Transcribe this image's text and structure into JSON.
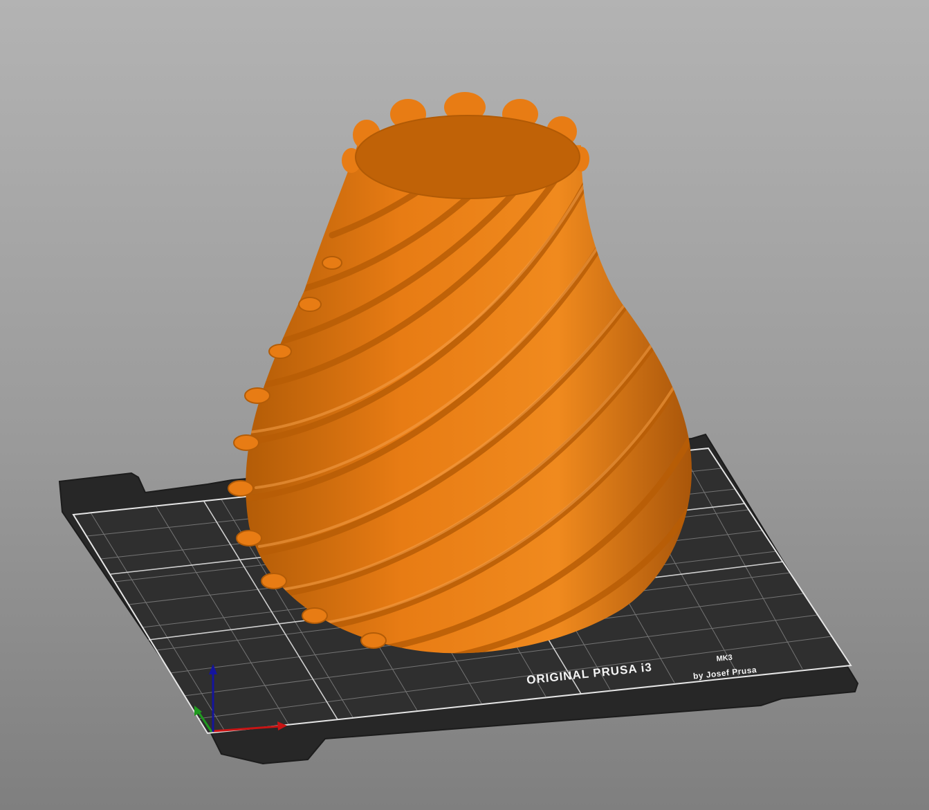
{
  "viewport": {
    "background_top": "#b3b3b3",
    "background_bottom": "#7f7f7f"
  },
  "bed": {
    "brand_text": "ORIGINAL PRUSA i3",
    "model_text": "MK3",
    "maker_text": "by Josef Prusa",
    "sheet_color": "#2c2c2c",
    "grid_color": "#9a9a9a"
  },
  "model": {
    "name": "twisted-spiral-vase",
    "color": "#e87c14"
  },
  "axes": {
    "x_color": "#c81414",
    "y_color": "#1f9a1f",
    "z_color": "#14149e"
  }
}
